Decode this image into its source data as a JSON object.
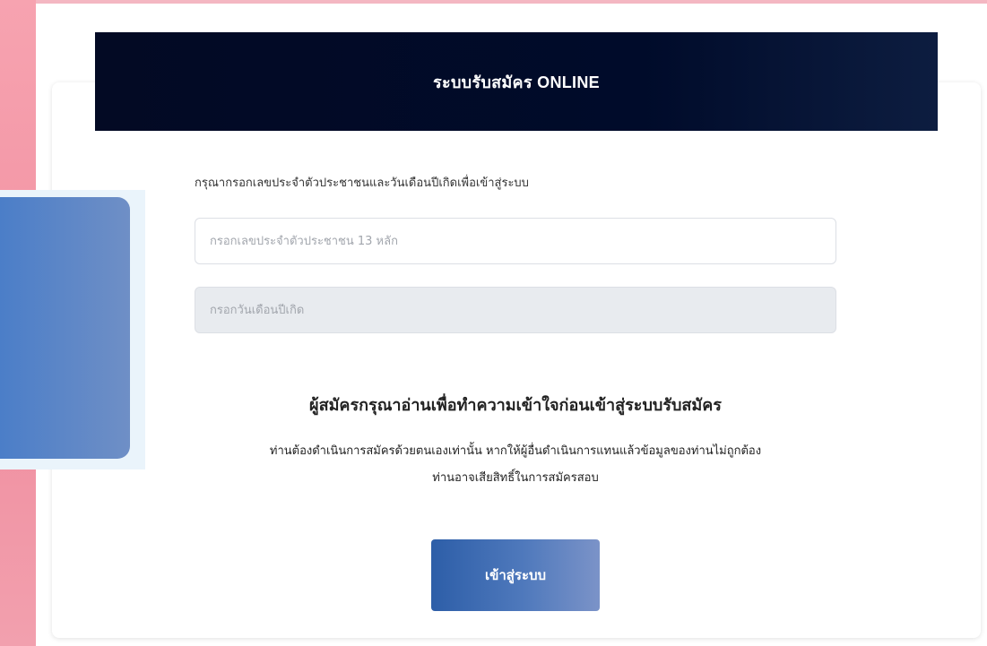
{
  "header": {
    "title": "ระบบรับสมัคร ONLINE"
  },
  "form": {
    "instruction": "กรุณากรอกเลขประจำตัวประชาชนและวันเดือนปีเกิดเพื่อเข้าสู่ระบบ",
    "id_field": {
      "placeholder": "กรอกเลขประจำตัวประชาชน 13 หลัก",
      "value": ""
    },
    "dob_field": {
      "placeholder": "กรอกวันเดือนปีเกิด",
      "value": ""
    }
  },
  "notice": {
    "title": "ผู้สมัครกรุณาอ่านเพื่อทำความเข้าใจก่อนเข้าสู่ระบบรับสมัคร",
    "line1": "ท่านต้องดำเนินการสมัครด้วยตนเองเท่านั้น หากให้ผู้อื่นดำเนินการแทนแล้วข้อมูลของท่านไม่ถูกต้อง",
    "line2": "ท่านอาจเสียสิทธิ์ในการสมัครสอบ"
  },
  "actions": {
    "login_button": "เข้าสู่ระบบ"
  },
  "colors": {
    "header_bg": "#000b2a",
    "button_start": "#2d5ea8",
    "button_end": "#7b93c8",
    "side_accent": "#f08fa0"
  }
}
